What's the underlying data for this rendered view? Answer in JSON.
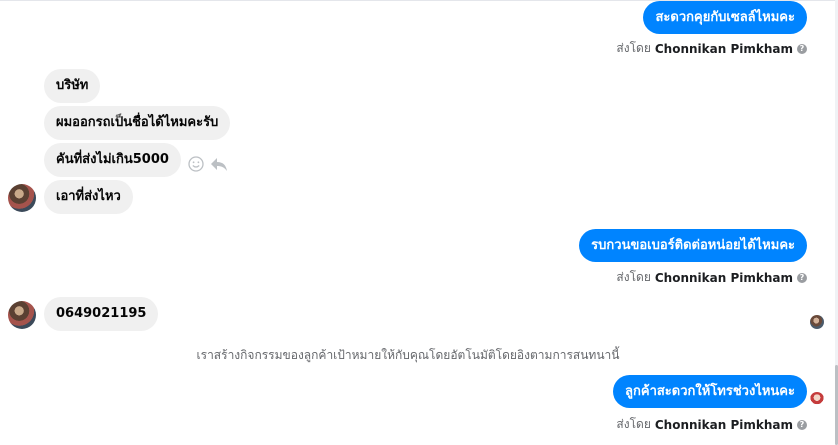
{
  "messages": [
    {
      "id": "out1",
      "text": "สะดวกคุยกับเซลล์ไหมคะ"
    },
    {
      "id": "in1",
      "text": "บริษัท"
    },
    {
      "id": "in2",
      "text": "ผมออกรถเป็นชื่อได้ไหมคะรับ"
    },
    {
      "id": "in3",
      "text": "คันที่ส่งไม่เกิน5000"
    },
    {
      "id": "in4",
      "text": "เอาที่ส่งไหว"
    },
    {
      "id": "out2",
      "text": "รบกวนขอเบอร์ติดต่อหน่อยได้ไหมคะ"
    },
    {
      "id": "in5",
      "text": "0649021195"
    },
    {
      "id": "out3",
      "text": "ลูกค้าสะดวกให้โทรช่วงไหนคะ"
    }
  ],
  "sent_by": {
    "prefix": "ส่งโดย",
    "name": "Chonnikan Pimkham"
  },
  "system_note": "เราสร้างกิจกรรมของลูกค้าเป้าหมายให้กับคุณโดยอัตโนมัติโดยอิงตามการสนทนานี้",
  "icons": {
    "react": "smiley-icon",
    "reply": "reply-icon",
    "info": "info-icon"
  },
  "colors": {
    "outgoing_bubble": "#0084ff",
    "incoming_bubble": "#f0f0f0",
    "muted_text": "#65676b"
  }
}
